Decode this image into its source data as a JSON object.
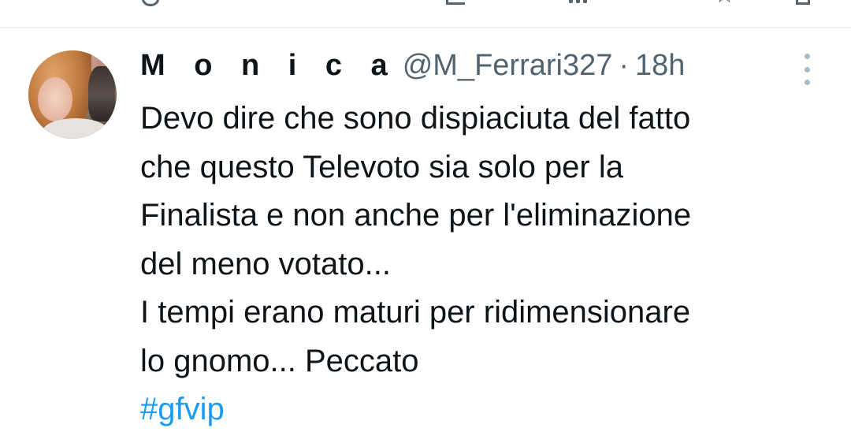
{
  "tweet": {
    "display_name": "M o n i c a",
    "handle": "@M_Ferrari327",
    "separator": "·",
    "time": "18h",
    "lines": [
      "Devo dire che sono dispiaciuta del fatto",
      "che questo Televoto sia solo per la",
      "Finalista e non anche per l'eliminazione",
      "del meno votato...",
      "I tempi erano maturi per ridimensionare",
      "lo gnomo... Peccato"
    ],
    "hashtag": "#gfvip"
  },
  "colors": {
    "text": "#0f1419",
    "secondary": "#536471",
    "link": "#1d9bf0",
    "divider": "#eff3f4"
  },
  "icons": {
    "more": "more-vertical-icon",
    "avatar": "avatar"
  }
}
